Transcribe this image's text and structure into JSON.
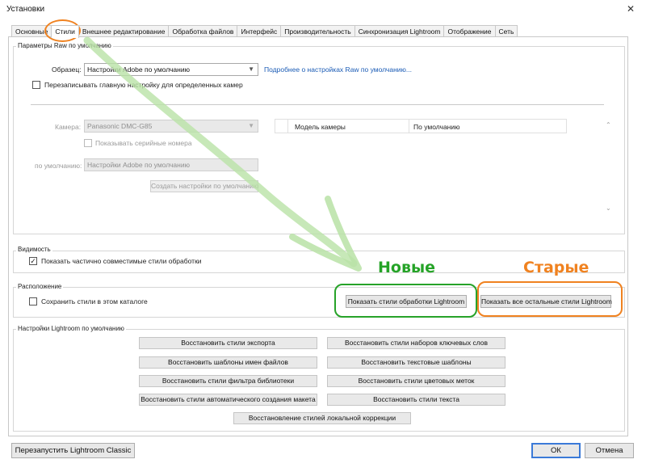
{
  "window": {
    "title": "Установки",
    "close_glyph": "✕"
  },
  "tabs": [
    {
      "label": "Основные"
    },
    {
      "label": "Стили",
      "active": true
    },
    {
      "label": "Внешнее редактирование"
    },
    {
      "label": "Обработка файлов"
    },
    {
      "label": "Интерфейс"
    },
    {
      "label": "Производительность"
    },
    {
      "label": "Синхронизация Lightroom"
    },
    {
      "label": "Отображение"
    },
    {
      "label": "Сеть"
    }
  ],
  "raw_defaults": {
    "group_label": "Параметры Raw по умолчанию",
    "master_label": "Образец:",
    "master_value": "Настройки Adobe по умолчанию",
    "learn_more_link": "Подробнее о настройках Raw по умолчанию...",
    "override_label": "Перезаписывать главную настройку для определенных камер",
    "camera_label": "Камера:",
    "camera_value": "Panasonic DMC-G85",
    "show_serial_label": "Показывать серийные номера",
    "default_label": "по умолчанию:",
    "default_value": "Настройки Adobe по умолчанию",
    "create_default_button": "Создать настройки по умолчанию",
    "table_headers": [
      "Модель камеры",
      "По умолчанию"
    ]
  },
  "visibility": {
    "group_label": "Видимость",
    "show_partial_label": "Показать частично совместимые стили обработки",
    "show_partial_checked": true
  },
  "location": {
    "group_label": "Расположение",
    "store_label": "Сохранить стили в этом каталоге",
    "store_checked": false,
    "show_lightroom_presets": "Показать стили обработки Lightroom",
    "show_other_presets": "Показать все остальные стили Lightroom"
  },
  "lightroom_defaults": {
    "group_label": "Настройки Lightroom по умолчанию",
    "buttons_left": [
      "Восстановить стили экспорта",
      "Восстановить шаблоны имен файлов",
      "Восстановить стили фильтра библиотеки",
      "Восстановить стили автоматического создания макета"
    ],
    "buttons_right": [
      "Восстановить стили наборов ключевых слов",
      "Восстановить текстовые шаблоны",
      "Восстановить стили цветовых меток",
      "Восстановить стили текста"
    ],
    "button_center": "Восстановление стилей локальной коррекции"
  },
  "annotations": {
    "new_label": "Новые",
    "old_label": "Старые"
  },
  "footer": {
    "restart_button": "Перезапустить Lightroom Classic",
    "ok_button": "ОК",
    "cancel_button": "Отмена"
  },
  "colors": {
    "annotation_green": "#25a327",
    "annotation_orange": "#f08220",
    "link_blue": "#1a5bb5"
  },
  "check_glyph": "✓"
}
